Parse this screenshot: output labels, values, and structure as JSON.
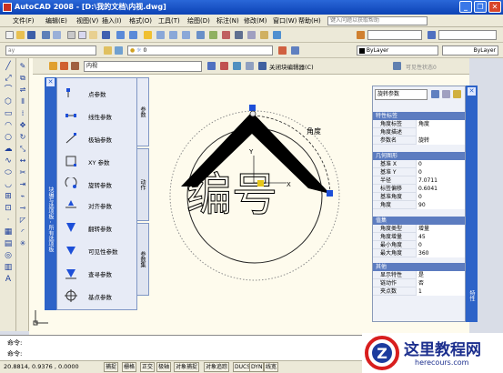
{
  "window": {
    "title": "AutoCAD 2008 - [D:\\我的文档\\内视.dwg]",
    "minimize": "_",
    "restore": "❐",
    "close": "✕"
  },
  "menubar": {
    "items": [
      "文件(F)",
      "编辑(E)",
      "视图(V)",
      "插入(I)",
      "格式(O)",
      "工具(T)",
      "绘图(D)",
      "标注(N)",
      "修改(M)",
      "窗口(W)",
      "帮助(H)"
    ],
    "search_placeholder": "键入问题以获取帮助"
  },
  "layer_toolbar": {
    "layer_value": "0",
    "linetype_value": "ByLayer",
    "lineweight_value": "ByLayer",
    "workspace": "ay"
  },
  "block_editor": {
    "block_name": "内视",
    "close_label": "关闭块编辑器(C)",
    "visibility_label": "可见性状态0"
  },
  "palette": {
    "caption": "块编写选项板 - 所有选项板",
    "items": [
      "点参数",
      "线性参数",
      "极轴参数",
      "XY 参数",
      "旋转参数",
      "对齐参数",
      "翻转参数",
      "可见性参数",
      "查寻参数",
      "基点参数"
    ],
    "tabs": [
      "参数",
      "动作",
      "参数集"
    ]
  },
  "canvas": {
    "text_main": "编号",
    "angle_label": "角度",
    "axis_x": "X",
    "axis_y": "Y"
  },
  "properties": {
    "selector": "旋转参数",
    "caption": "特性",
    "sections": [
      {
        "title": "特性标签",
        "rows": [
          {
            "k": "角度标签",
            "v": "角度"
          },
          {
            "k": "角度描述",
            "v": ""
          },
          {
            "k": "参数名",
            "v": "旋转"
          }
        ]
      },
      {
        "title": "几何图形",
        "rows": [
          {
            "k": "基准 X",
            "v": "0"
          },
          {
            "k": "基准 Y",
            "v": "0"
          },
          {
            "k": "半径",
            "v": "7.0711"
          },
          {
            "k": "标签偏移",
            "v": "0.6041"
          },
          {
            "k": "基准角度",
            "v": "0"
          },
          {
            "k": "角度",
            "v": "90"
          }
        ]
      },
      {
        "title": "值集",
        "rows": [
          {
            "k": "角度类型",
            "v": "增量"
          },
          {
            "k": "角度增量",
            "v": "45"
          },
          {
            "k": "最小角度",
            "v": "0"
          },
          {
            "k": "最大角度",
            "v": "360"
          }
        ]
      },
      {
        "title": "其他",
        "rows": [
          {
            "k": "显示特性",
            "v": "是"
          },
          {
            "k": "链动作",
            "v": "否"
          },
          {
            "k": "夹点数",
            "v": "1"
          }
        ]
      }
    ]
  },
  "command": {
    "line1": "命令:",
    "line2": "命令:"
  },
  "status": {
    "coords": "20.8814, 0.9376 , 0.0000",
    "buttons": [
      "捕捉",
      "栅格",
      "正交",
      "极轴",
      "对象捕捉",
      "对象追踪",
      "DUCS",
      "DYN",
      "线宽"
    ]
  },
  "watermark": {
    "text": "这里教程网",
    "url": "herecours.com",
    "letter": "Z"
  },
  "colors": {
    "title": "#0c42b5",
    "accent": "#2d63c8",
    "grip": "#1d4fd8",
    "canvas": "#fefbed"
  }
}
